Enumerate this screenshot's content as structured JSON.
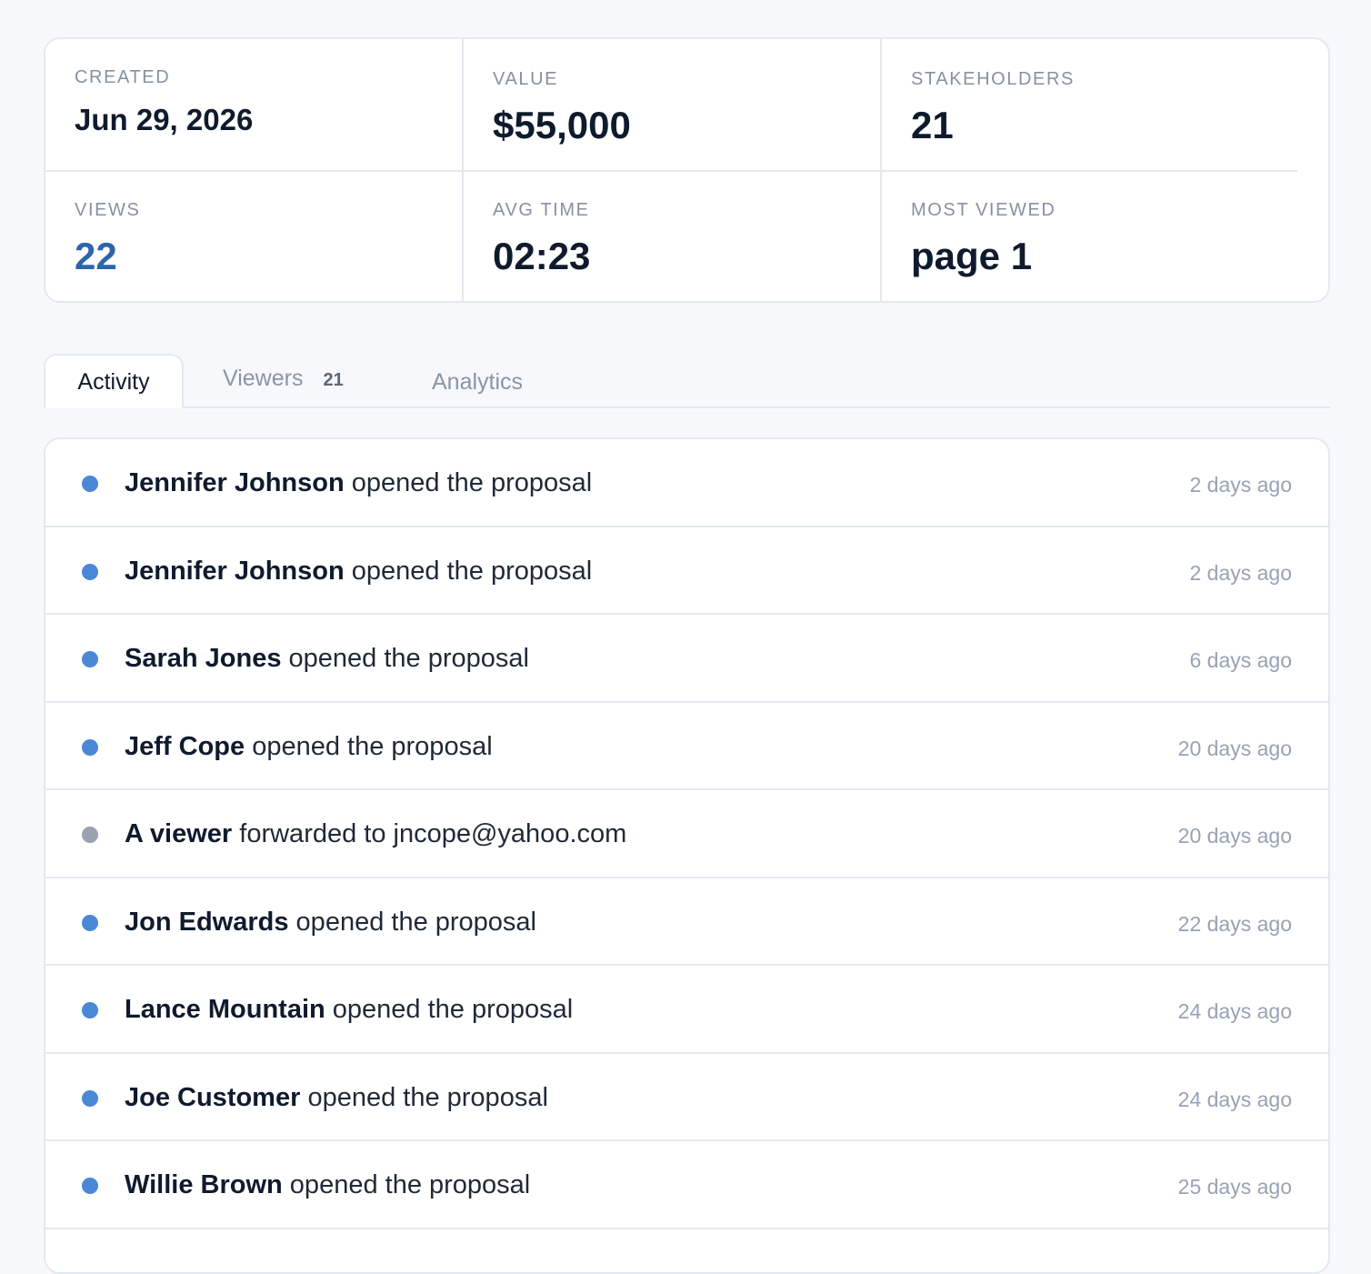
{
  "stats": [
    {
      "label": "CREATED",
      "value": "Jun 29, 2026"
    },
    {
      "label": "VALUE",
      "value": "$55,000"
    },
    {
      "label": "STAKEHOLDERS",
      "value": "21"
    },
    {
      "label": "VIEWS",
      "value": "22"
    },
    {
      "label": "AVG TIME",
      "value": "02:23"
    },
    {
      "label": "MOST VIEWED",
      "value": "page 1"
    }
  ],
  "tabs": {
    "activity": "Activity",
    "viewers": "Viewers",
    "viewers_count": "21",
    "analytics": "Analytics"
  },
  "activity": [
    {
      "who": "Jennifer Johnson",
      "action": " opened the proposal",
      "time": "2 days ago",
      "dot": "blue"
    },
    {
      "who": "Jennifer Johnson",
      "action": " opened the proposal",
      "time": "2 days ago",
      "dot": "blue"
    },
    {
      "who": "Sarah Jones",
      "action": " opened the proposal",
      "time": "6 days ago",
      "dot": "blue"
    },
    {
      "who": "Jeff Cope",
      "action": " opened the proposal",
      "time": "20 days ago",
      "dot": "blue"
    },
    {
      "who": "A viewer",
      "action": " forwarded to jncope@yahoo.com",
      "time": "20 days ago",
      "dot": "gray"
    },
    {
      "who": "Jon Edwards",
      "action": " opened the proposal",
      "time": "22 days ago",
      "dot": "blue"
    },
    {
      "who": "Lance Mountain",
      "action": " opened the proposal",
      "time": "24 days ago",
      "dot": "blue"
    },
    {
      "who": "Joe Customer",
      "action": " opened the proposal",
      "time": "24 days ago",
      "dot": "blue"
    },
    {
      "who": "Willie Brown",
      "action": " opened the proposal",
      "time": "25 days ago",
      "dot": "blue"
    }
  ],
  "colors": {
    "accent_blue": "#4a88d6",
    "link_blue": "#2c66a8",
    "muted_gray": "#9aa2b0"
  }
}
